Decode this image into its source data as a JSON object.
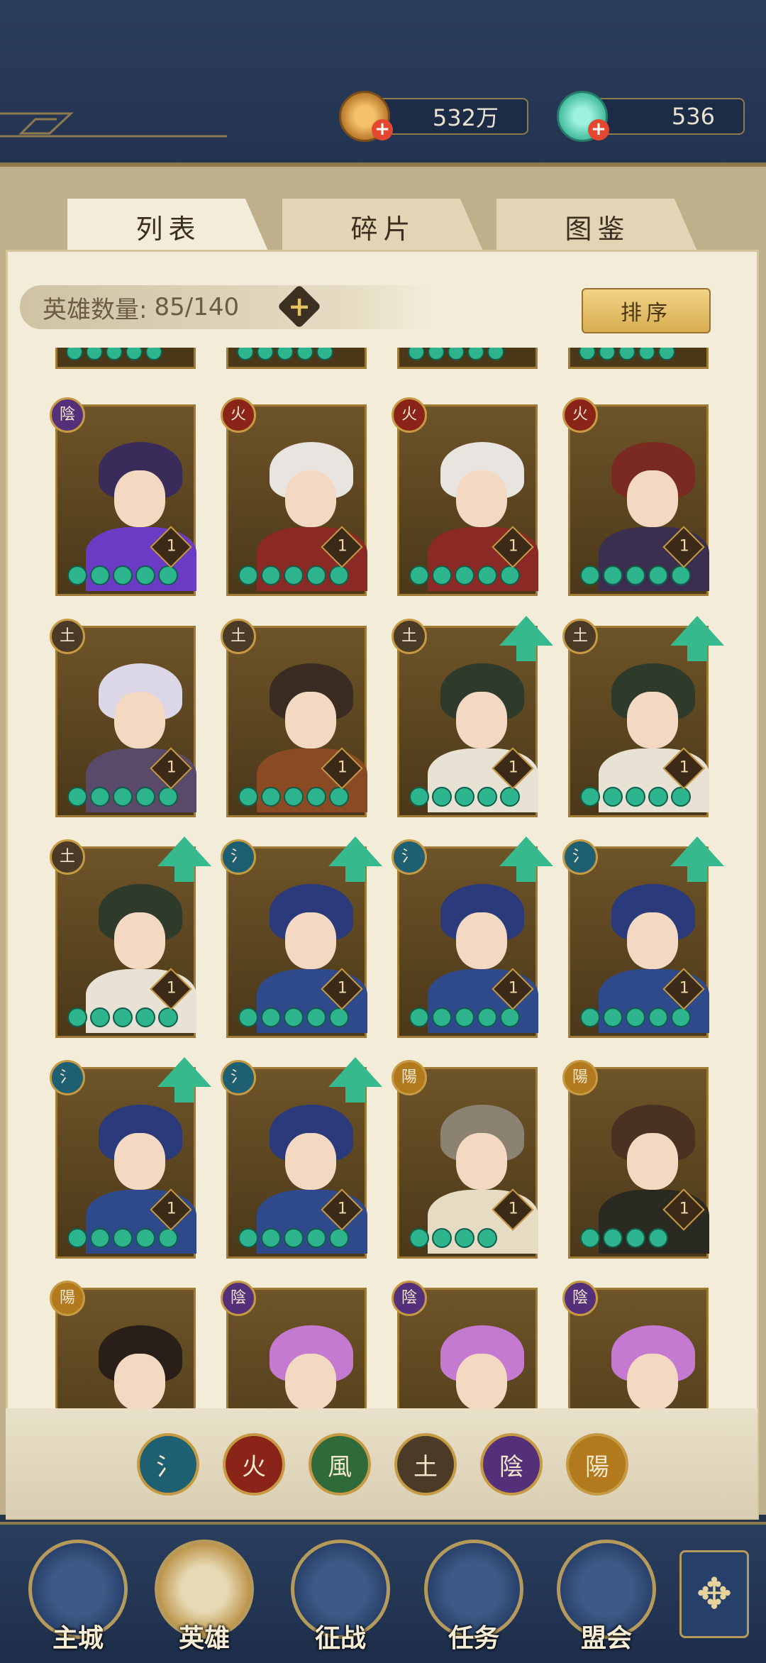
{
  "resources": {
    "coin": {
      "value": "532万",
      "icon": "copper-coin-icon"
    },
    "jade": {
      "value": "536",
      "icon": "jade-icon"
    }
  },
  "tabs": [
    "列表",
    "碎片",
    "图鉴"
  ],
  "hero_count": {
    "label": "英雄数量:",
    "value": "85/140"
  },
  "sort_label": "排序",
  "element_glyphs": {
    "water": "氵",
    "fire": "火",
    "wind": "風",
    "earth": "土",
    "yin": "陰",
    "yang": "陽"
  },
  "element_colors": {
    "water": "#1f5f72",
    "fire": "#8a2318",
    "wind": "#2f6a3a",
    "earth": "#4a3a26",
    "yin": "#55307a",
    "yang": "#b27a1c"
  },
  "heroes": [
    {
      "element": "yin",
      "level": "1",
      "upgrade": false,
      "hair": "#3a2c5a",
      "body": "#6a3bc4",
      "beads": 5
    },
    {
      "element": "fire",
      "level": "1",
      "upgrade": false,
      "hair": "#e8e4e0",
      "body": "#8b2a24",
      "beads": 5
    },
    {
      "element": "fire",
      "level": "1",
      "upgrade": false,
      "hair": "#e8e4e0",
      "body": "#8b2a24",
      "beads": 5
    },
    {
      "element": "fire",
      "level": "1",
      "upgrade": false,
      "hair": "#7a2a20",
      "body": "#3a2f4e",
      "beads": 5
    },
    {
      "element": "earth",
      "level": "1",
      "upgrade": false,
      "hair": "#dcd7e6",
      "body": "#5a4a6a",
      "beads": 5
    },
    {
      "element": "earth",
      "level": "1",
      "upgrade": false,
      "hair": "#3a2c20",
      "body": "#8a4a24",
      "beads": 5
    },
    {
      "element": "earth",
      "level": "1",
      "upgrade": true,
      "hair": "#2e3a2a",
      "body": "#e8e2d4",
      "beads": 5
    },
    {
      "element": "earth",
      "level": "1",
      "upgrade": true,
      "hair": "#2e3a2a",
      "body": "#e8e2d4",
      "beads": 5
    },
    {
      "element": "earth",
      "level": "1",
      "upgrade": true,
      "hair": "#2e3a2a",
      "body": "#e8e2d4",
      "beads": 5
    },
    {
      "element": "water",
      "level": "1",
      "upgrade": true,
      "hair": "#2a3a7a",
      "body": "#2f4a8a",
      "beads": 5
    },
    {
      "element": "water",
      "level": "1",
      "upgrade": true,
      "hair": "#2a3a7a",
      "body": "#2f4a8a",
      "beads": 5
    },
    {
      "element": "water",
      "level": "1",
      "upgrade": true,
      "hair": "#2a3a7a",
      "body": "#2f4a8a",
      "beads": 5
    },
    {
      "element": "water",
      "level": "1",
      "upgrade": true,
      "hair": "#2a3a7a",
      "body": "#2f4a8a",
      "beads": 5
    },
    {
      "element": "water",
      "level": "1",
      "upgrade": true,
      "hair": "#2a3a7a",
      "body": "#2f4a8a",
      "beads": 5
    },
    {
      "element": "yang",
      "level": "1",
      "upgrade": false,
      "hair": "#8c8272",
      "body": "#e6dcc4",
      "beads": 4
    },
    {
      "element": "yang",
      "level": "1",
      "upgrade": false,
      "hair": "#4a3222",
      "body": "#2a2a22",
      "beads": 4
    },
    {
      "element": "yang",
      "level": "",
      "upgrade": false,
      "hair": "#2a1e18",
      "body": "#d9cfb8",
      "beads": 0
    },
    {
      "element": "yin",
      "level": "",
      "upgrade": false,
      "hair": "#c47ad0",
      "body": "#2e3150",
      "beads": 0
    },
    {
      "element": "yin",
      "level": "",
      "upgrade": false,
      "hair": "#c47ad0",
      "body": "#2e3150",
      "beads": 0
    },
    {
      "element": "yin",
      "level": "",
      "upgrade": false,
      "hair": "#c47ad0",
      "body": "#2e3150",
      "beads": 0
    }
  ],
  "filters": [
    "water",
    "fire",
    "wind",
    "earth",
    "yin",
    "yang"
  ],
  "nav": [
    {
      "label": "主城",
      "icon": "city-gate-icon"
    },
    {
      "label": "英雄",
      "icon": "hero-portrait-icon"
    },
    {
      "label": "征战",
      "icon": "battle-drum-icon"
    },
    {
      "label": "任务",
      "icon": "quest-scroll-icon"
    },
    {
      "label": "盟会",
      "icon": "alliance-pavilion-icon"
    }
  ],
  "nav_extra": {
    "glyph": "✥",
    "icon": "more-menu-icon"
  }
}
